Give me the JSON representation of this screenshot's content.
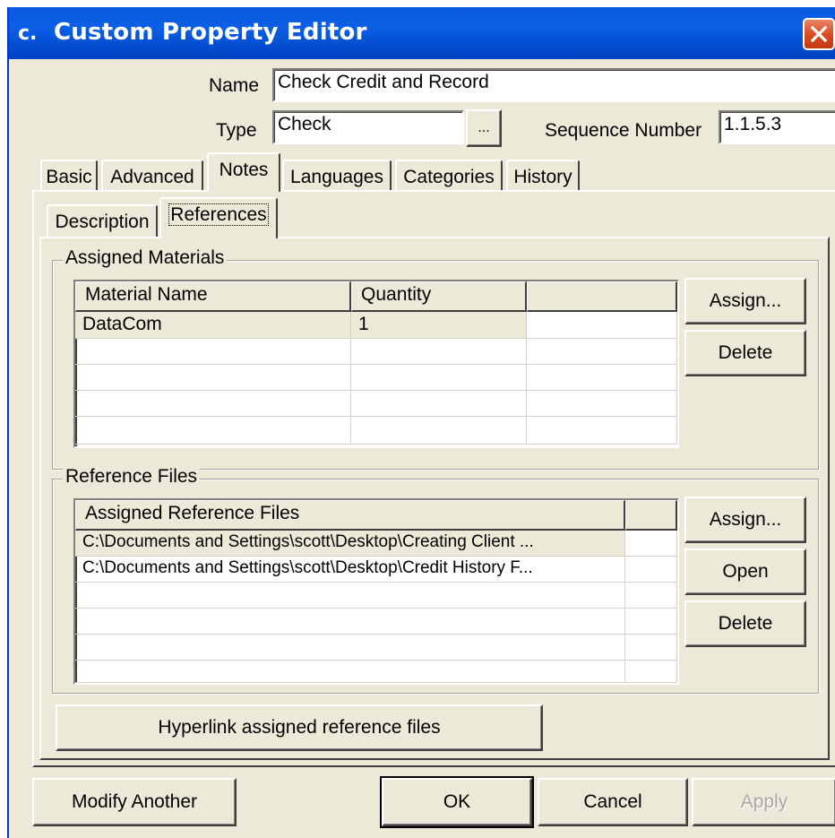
{
  "window": {
    "title": "Custom Property Editor",
    "app_icon_text": "c."
  },
  "form": {
    "name_label": "Name",
    "name_value": "Check Credit and Record",
    "type_label": "Type",
    "type_value": "Check",
    "browse_label": "...",
    "sequence_label": "Sequence Number",
    "sequence_value": "1.1.5.3"
  },
  "tabs": [
    "Basic",
    "Advanced",
    "Notes",
    "Languages",
    "Categories",
    "History"
  ],
  "active_tab": "Notes",
  "subtabs": [
    "Description",
    "References"
  ],
  "active_subtab": "References",
  "materials": {
    "group_title": "Assigned Materials",
    "columns": [
      "Material Name",
      "Quantity",
      ""
    ],
    "rows": [
      [
        "DataCom",
        "1",
        ""
      ]
    ],
    "assign_label": "Assign...",
    "delete_label": "Delete"
  },
  "reference_files": {
    "group_title": "Reference Files",
    "columns": [
      "Assigned Reference Files",
      ""
    ],
    "rows": [
      [
        "C:\\Documents and Settings\\scott\\Desktop\\Creating Client ...",
        ""
      ],
      [
        "C:\\Documents and Settings\\scott\\Desktop\\Credit History F...",
        ""
      ]
    ],
    "assign_label": "Assign...",
    "open_label": "Open",
    "delete_label": "Delete",
    "hyperlink_label": "Hyperlink assigned reference files"
  },
  "footer": {
    "modify_another_label": "Modify Another",
    "ok_label": "OK",
    "cancel_label": "Cancel",
    "apply_label": "Apply"
  },
  "colors": {
    "titlebar": "#0054e3",
    "close_button": "#d9481e",
    "dialog_face": "#ece9d8"
  }
}
